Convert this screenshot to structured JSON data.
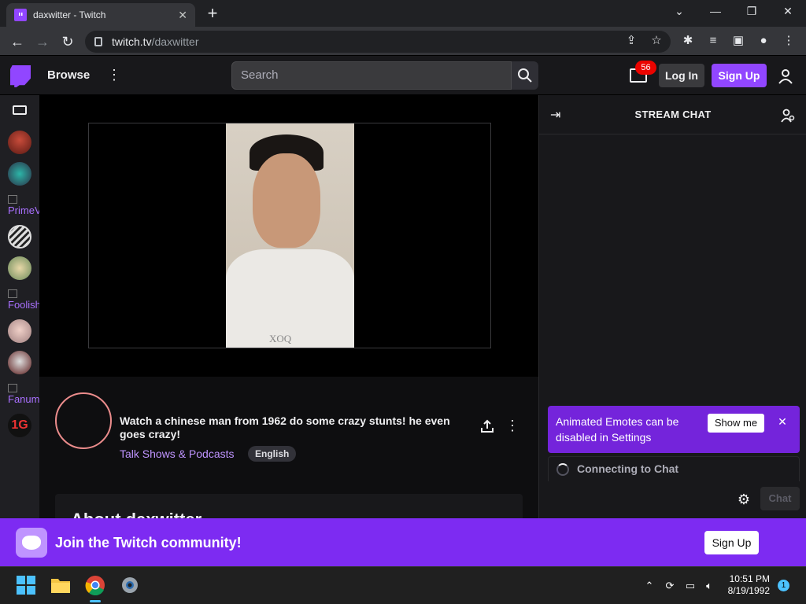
{
  "browser": {
    "tab_title": "daxwitter - Twitch",
    "tab_close": "✕",
    "new_tab": "+",
    "url_host": "twitch.tv",
    "url_path": "/daxwitter",
    "window_minimize": "—",
    "window_restore": "❐",
    "window_close": "✕"
  },
  "header": {
    "browse": "Browse",
    "search_placeholder": "Search",
    "inbox_count": "56",
    "login": "Log In",
    "signup": "Sign Up"
  },
  "sidebar": {
    "broken_labels": [
      "PrimeV",
      "Foolish",
      "Fanum"
    ]
  },
  "video": {
    "shirt_text": "XOQ"
  },
  "stream_info": {
    "title": "Watch a chinese man from 1962 do some crazy stunts! he even goes crazy!",
    "category": "Talk Shows & Podcasts",
    "language_tag": "English",
    "about_heading": "About daxwitter"
  },
  "chat": {
    "title": "STREAM CHAT",
    "notice_text": "Animated Emotes can be disabled in Settings",
    "notice_button": "Show me",
    "notice_close": "✕",
    "connecting": "Connecting to Chat",
    "chat_button": "Chat"
  },
  "join_banner": {
    "text": "Join the Twitch community!",
    "signup": "Sign Up"
  },
  "taskbar": {
    "time": "10:51 PM",
    "date": "8/19/1992",
    "notification_count": "1"
  },
  "colors": {
    "twitch_purple": "#9146ff",
    "banner_purple": "#7d2bf2",
    "badge_red": "#eb0400",
    "category_link": "#bf94ff"
  }
}
